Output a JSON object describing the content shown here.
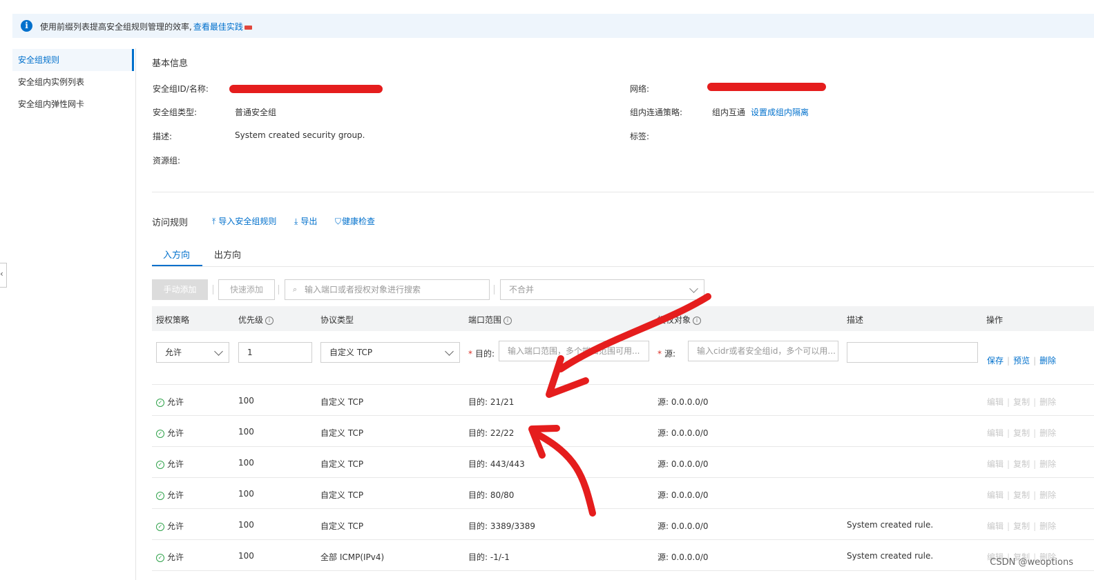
{
  "notice": {
    "text": "使用前缀列表提高安全组规则管理的效率,",
    "link": "查看最佳实践"
  },
  "sidenav": {
    "items": [
      {
        "label": "安全组规则",
        "active": true
      },
      {
        "label": "安全组内实例列表",
        "active": false
      },
      {
        "label": "安全组内弹性网卡",
        "active": false
      }
    ]
  },
  "basic": {
    "title": "基本信息",
    "id_label": "安全组ID/名称:",
    "network_label": "网络:",
    "type_label": "安全组类型:",
    "type_value": "普通安全组",
    "policy_label": "组内连通策略:",
    "policy_value": "组内互通",
    "policy_link": "设置成组内隔离",
    "desc_label": "描述:",
    "desc_value": "System created security group.",
    "tag_label": "标签:",
    "rg_label": "资源组:"
  },
  "toolbar": {
    "title": "访问规则",
    "import": "导入安全组规则",
    "export": "导出",
    "health": "健康检查"
  },
  "tabs": [
    {
      "label": "入方向",
      "active": true
    },
    {
      "label": "出方向",
      "active": false
    }
  ],
  "controls": {
    "manual_add": "手动添加",
    "quick_add": "快速添加",
    "search_placeholder": "输入端口或者授权对象进行搜索",
    "merge_placeholder": "不合并"
  },
  "table": {
    "headers": [
      "授权策略",
      "优先级",
      "协议类型",
      "端口范围",
      "授权对象",
      "描述",
      "操作"
    ],
    "edit_row": {
      "policy": "允许",
      "priority": "1",
      "protocol": "自定义 TCP",
      "dest_label": "目的:",
      "dest_placeholder": "输入端口范围，多个端口范围可用...",
      "src_label": "源:",
      "src_placeholder": "输入cidr或者安全组id，多个可以用...",
      "ops": [
        "保存",
        "预览",
        "删除"
      ]
    },
    "rows": [
      {
        "policy": "允许",
        "priority": "100",
        "protocol": "自定义 TCP",
        "port": "目的: 21/21",
        "source": "源: 0.0.0.0/0",
        "desc": ""
      },
      {
        "policy": "允许",
        "priority": "100",
        "protocol": "自定义 TCP",
        "port": "目的: 22/22",
        "source": "源: 0.0.0.0/0",
        "desc": ""
      },
      {
        "policy": "允许",
        "priority": "100",
        "protocol": "自定义 TCP",
        "port": "目的: 443/443",
        "source": "源: 0.0.0.0/0",
        "desc": ""
      },
      {
        "policy": "允许",
        "priority": "100",
        "protocol": "自定义 TCP",
        "port": "目的: 80/80",
        "source": "源: 0.0.0.0/0",
        "desc": ""
      },
      {
        "policy": "允许",
        "priority": "100",
        "protocol": "自定义 TCP",
        "port": "目的: 3389/3389",
        "source": "源: 0.0.0.0/0",
        "desc": "System created rule."
      },
      {
        "policy": "允许",
        "priority": "100",
        "protocol": "全部 ICMP(IPv4)",
        "port": "目的: -1/-1",
        "source": "源: 0.0.0.0/0",
        "desc": "System created rule."
      }
    ],
    "row_ops": [
      "编辑",
      "复制",
      "删除"
    ]
  },
  "watermark": "CSDN @weoptions",
  "colors": {
    "accent": "#0070cc",
    "annotation": "#e51d1d",
    "success": "#2fa24a"
  }
}
